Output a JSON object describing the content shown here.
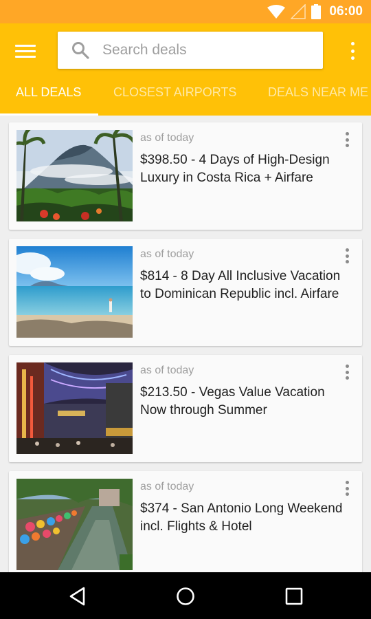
{
  "status_bar": {
    "time": "06:00",
    "icons": [
      "wifi-icon",
      "signal-icon",
      "battery-icon"
    ],
    "color": "#ffa726"
  },
  "app_bar": {
    "color": "#ffc107",
    "menu_icon": "hamburger-menu-icon",
    "search": {
      "placeholder": "Search deals",
      "value": "",
      "icon": "search-icon"
    },
    "overflow_icon": "more-vert-icon"
  },
  "tabs": [
    {
      "label": "ALL DEALS",
      "active": true
    },
    {
      "label": "CLOSEST AIRPORTS",
      "active": false
    },
    {
      "label": "DEALS NEAR ME",
      "active": false
    }
  ],
  "deals": [
    {
      "date": "as of today",
      "title": "$398.50 - 4 Days of High-Design Luxury in Costa Rica + Airfare",
      "image": "volcano-jungle-photo"
    },
    {
      "date": "as of today",
      "title": "$814 - 8 Day All Inclusive Vacation to Dominican Republic incl. Airfare",
      "image": "beach-ocean-photo"
    },
    {
      "date": "as of today",
      "title": "$213.50 - Vegas Value Vacation Now through Summer",
      "image": "vegas-street-photo"
    },
    {
      "date": "as of today",
      "title": "$374 - San Antonio Long Weekend incl. Flights & Hotel",
      "image": "riverwalk-photo"
    }
  ],
  "nav_bar": {
    "buttons": [
      "back-icon",
      "home-icon",
      "recents-icon"
    ]
  }
}
